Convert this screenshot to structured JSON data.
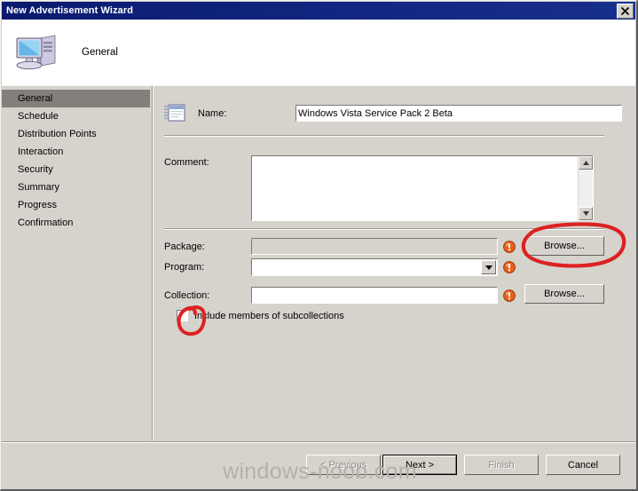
{
  "window": {
    "title": "New Advertisement Wizard",
    "close_label": "x",
    "close_icon": "close-icon"
  },
  "header": {
    "title": "General",
    "icon": "computer-icon"
  },
  "sidebar": {
    "items": [
      {
        "label": "General",
        "selected": true
      },
      {
        "label": "Schedule",
        "selected": false
      },
      {
        "label": "Distribution Points",
        "selected": false
      },
      {
        "label": "Interaction",
        "selected": false
      },
      {
        "label": "Security",
        "selected": false
      },
      {
        "label": "Summary",
        "selected": false
      },
      {
        "label": "Progress",
        "selected": false
      },
      {
        "label": "Confirmation",
        "selected": false
      }
    ]
  },
  "form": {
    "name": {
      "label": "Name:",
      "value": "Windows Vista Service Pack 2 Beta",
      "placeholder": "",
      "icon": "advertisement-icon"
    },
    "comment": {
      "label": "Comment:",
      "value": "",
      "placeholder": "",
      "scroll_up_icon": "scroll-up-arrow-icon",
      "scroll_down_icon": "scroll-down-arrow-icon"
    },
    "package": {
      "label": "Package:",
      "value": "",
      "placeholder": "",
      "disabled": true,
      "warning_icon": "warning-icon",
      "browse_label": "Browse..."
    },
    "program": {
      "label": "Program:",
      "value": "",
      "placeholder": "",
      "warning_icon": "warning-icon",
      "dropdown_icon": "chevron-down-icon"
    },
    "collection": {
      "label": "Collection:",
      "value": "",
      "placeholder": "",
      "warning_icon": "warning-icon",
      "browse_label": "Browse..."
    },
    "include_subcollections": {
      "label": "Include members of subcollections",
      "checked": false
    }
  },
  "footer": {
    "previous_label": "< Previous",
    "next_label": "Next >",
    "finish_label": "Finish",
    "cancel_label": "Cancel"
  },
  "watermark": {
    "text": "windows-noob.com"
  },
  "colors": {
    "titlebar_start": "#0a1a6e",
    "titlebar_end": "#17308c",
    "dialog_face": "#d6d3cd",
    "sidebar_selected": "#847f7b",
    "annotation_red": "#dd2222",
    "warning_orange": "#e8601c",
    "watermark_gray": "#b4b1ab"
  },
  "annotations": [
    {
      "name": "browse-package-circle",
      "shape": "ellipse"
    },
    {
      "name": "subcollections-checkbox-circle",
      "shape": "ellipse"
    }
  ]
}
